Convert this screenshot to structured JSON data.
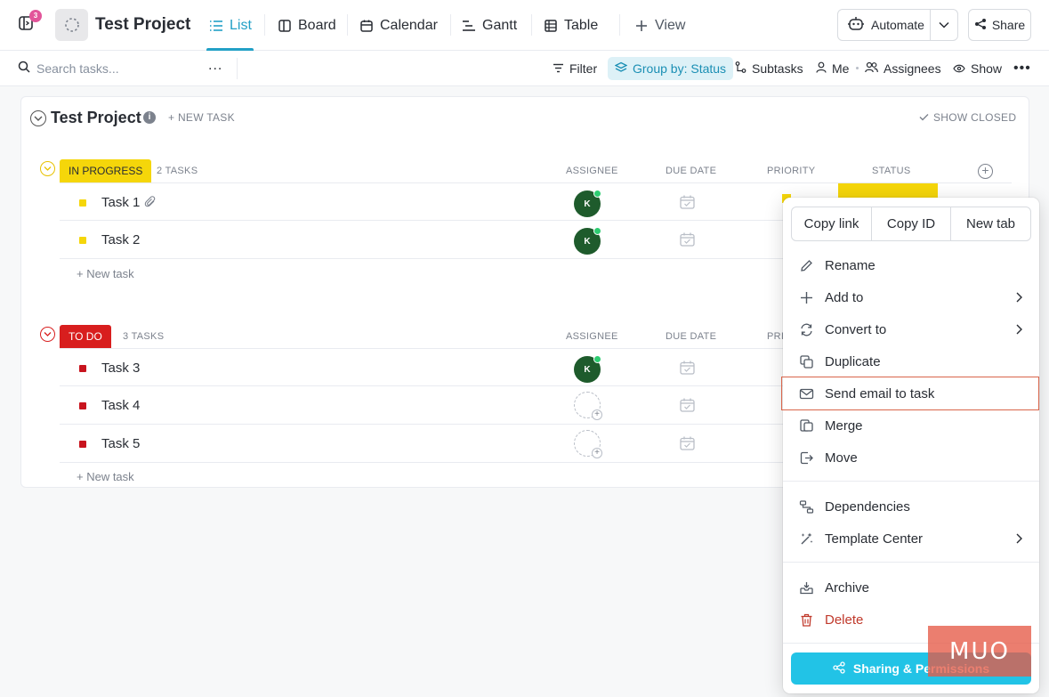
{
  "header": {
    "notification_count": "3",
    "project_title": "Test Project",
    "tabs": [
      {
        "label": "List",
        "icon": "list-icon",
        "active": true
      },
      {
        "label": "Board",
        "icon": "board-icon"
      },
      {
        "label": "Calendar",
        "icon": "calendar-icon"
      },
      {
        "label": "Gantt",
        "icon": "gantt-icon"
      },
      {
        "label": "Table",
        "icon": "table-icon"
      }
    ],
    "add_view_label": "View",
    "automate_label": "Automate",
    "share_label": "Share"
  },
  "toolbar": {
    "search_placeholder": "Search tasks...",
    "more_label": "...",
    "filter_label": "Filter",
    "group_by_label": "Group by: Status",
    "subtasks_label": "Subtasks",
    "me_label": "Me",
    "assignees_label": "Assignees",
    "show_label": "Show"
  },
  "list": {
    "title": "Test Project",
    "new_task_label": "+ NEW TASK",
    "show_closed_label": "SHOW CLOSED",
    "columns": {
      "assignee": "ASSIGNEE",
      "due_date": "DUE DATE",
      "priority": "PRIORITY",
      "priority_truncated": "PRI",
      "status": "STATUS"
    },
    "add_task_label": "+ New task",
    "groups": [
      {
        "status": "IN PROGRESS",
        "color": "#f5d60a",
        "count_label": "2 TASKS",
        "tasks": [
          {
            "name": "Task 1",
            "assignee": "K",
            "has_attachment": true
          },
          {
            "name": "Task 2",
            "assignee": "K"
          }
        ]
      },
      {
        "status": "TO DO",
        "color": "#d81e1e",
        "count_label": "3 TASKS",
        "tasks": [
          {
            "name": "Task 3",
            "assignee": "K"
          },
          {
            "name": "Task 4",
            "assignee": ""
          },
          {
            "name": "Task 5",
            "assignee": ""
          }
        ]
      }
    ]
  },
  "context_menu": {
    "copy_link": "Copy link",
    "copy_id": "Copy ID",
    "new_tab": "New tab",
    "items": [
      {
        "label": "Rename",
        "icon": "pencil-icon"
      },
      {
        "label": "Add to",
        "icon": "plus-icon",
        "submenu": true
      },
      {
        "label": "Convert to",
        "icon": "convert-icon",
        "submenu": true
      },
      {
        "label": "Duplicate",
        "icon": "duplicate-icon"
      },
      {
        "label": "Send email to task",
        "icon": "mail-icon",
        "highlighted": true
      },
      {
        "label": "Merge",
        "icon": "merge-icon"
      },
      {
        "label": "Move",
        "icon": "move-icon"
      },
      {
        "label": "Dependencies",
        "icon": "dependencies-icon"
      },
      {
        "label": "Template Center",
        "icon": "template-icon",
        "submenu": true
      },
      {
        "label": "Archive",
        "icon": "archive-icon"
      },
      {
        "label": "Delete",
        "icon": "trash-icon",
        "danger": true
      }
    ],
    "sharing_label": "Sharing & Permissions"
  },
  "watermark": "MUO",
  "colors": {
    "accent": "#22a0c6",
    "in_progress": "#f5d60a",
    "to_do": "#d81e1e",
    "highlight_border": "#d9654b",
    "sharing_button": "#22c3e6"
  }
}
